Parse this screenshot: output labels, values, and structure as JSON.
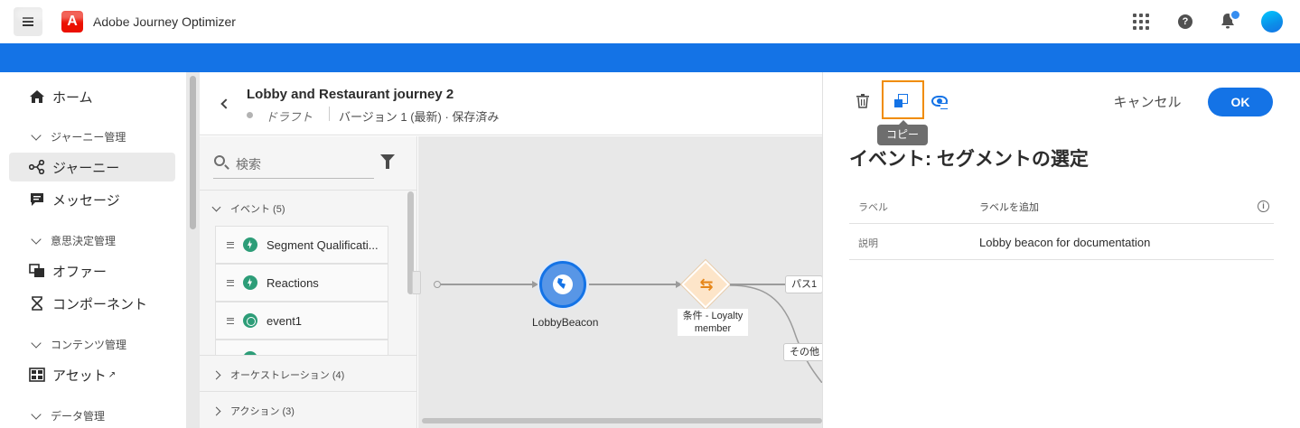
{
  "app": {
    "title": "Adobe Journey Optimizer",
    "logo_letter": "A"
  },
  "colors": {
    "brand_blue": "#1473e6",
    "adobe_red": "#eb1000",
    "event_green": "#2d9d78",
    "condition_orange": "#e68619",
    "focus_orange": "#f08c00"
  },
  "sidebar": {
    "home": "ホーム",
    "sections": {
      "journey_mgmt": "ジャーニー管理",
      "decision_mgmt": "意思決定管理",
      "content_mgmt": "コンテンツ管理",
      "data_mgmt": "データ管理"
    },
    "items": {
      "journeys": "ジャーニー",
      "messages": "メッセージ",
      "offers": "オファー",
      "components": "コンポーネント",
      "assets": "アセット"
    }
  },
  "journey": {
    "title": "Lobby and Restaurant journey 2",
    "status": "ドラフト",
    "version": "バージョン 1 (最新) · 保存済み"
  },
  "palette": {
    "search_placeholder": "検索",
    "events_header": "イベント (5)",
    "events": [
      "Segment Qualificati...",
      "Reactions",
      "event1"
    ],
    "orchestration_header": "オーケストレーション (4)",
    "actions_header": "アクション (3)"
  },
  "canvas": {
    "node_event_label": "LobbyBeacon",
    "node_condition_label": "条件 - Loyalty member",
    "path1": "パス1",
    "path_other": "その他"
  },
  "panel": {
    "copy_tooltip": "コピー",
    "cancel": "キャンセル",
    "ok": "OK",
    "title": "イベント: セグメントの選定",
    "label_key": "ラベル",
    "label_value": "ラベルを追加",
    "desc_key": "説明",
    "desc_value": "Lobby beacon for documentation"
  }
}
